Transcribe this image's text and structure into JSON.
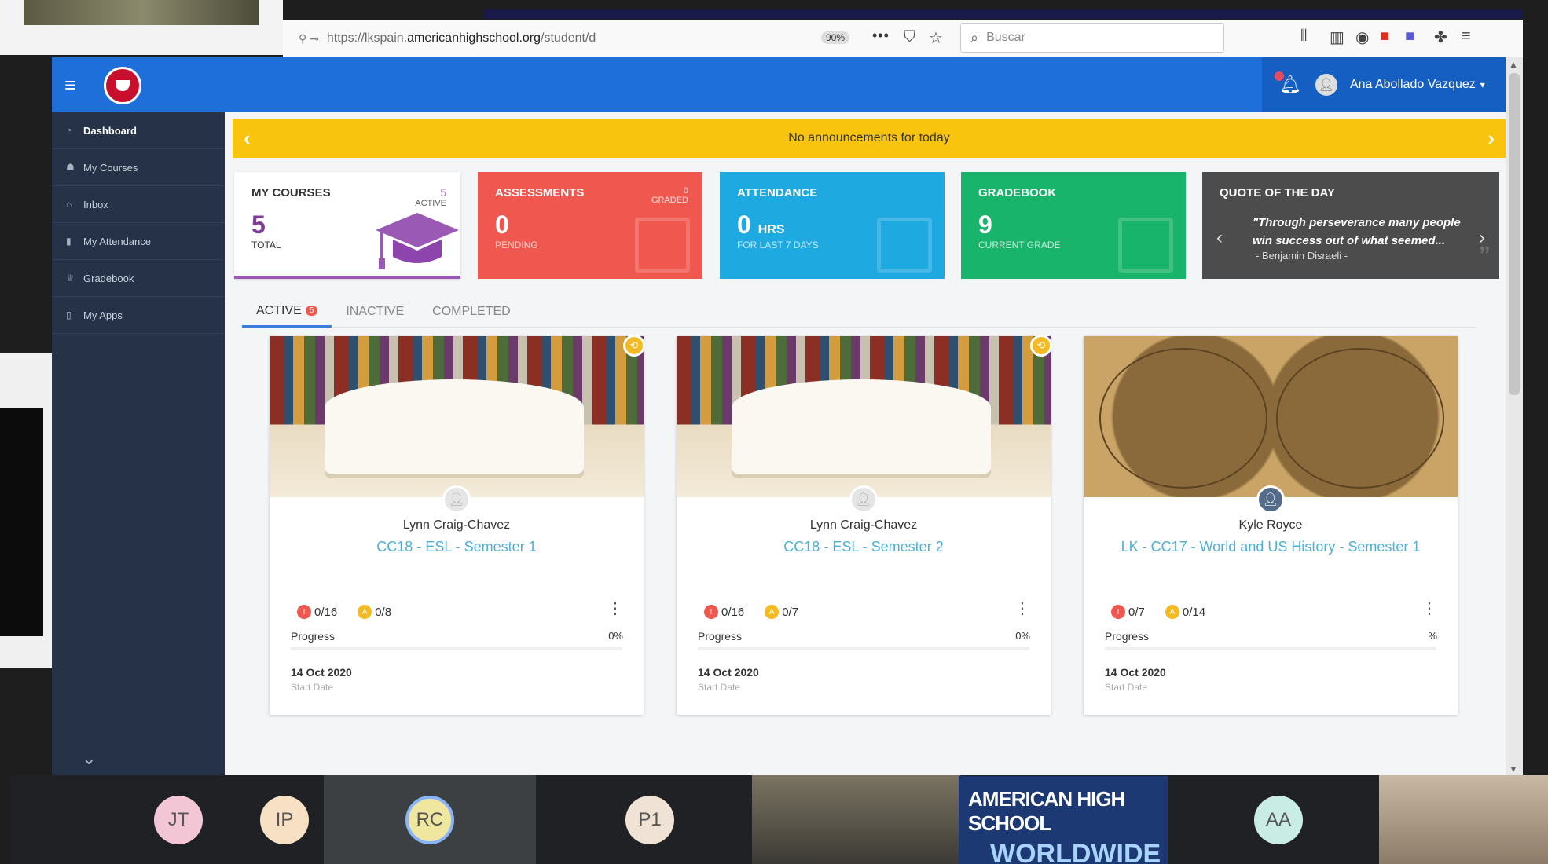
{
  "browser": {
    "url_prefix": "https://lkspain.",
    "url_domain": "americanhighschool.org",
    "url_path": "/student/d",
    "zoom": "90%",
    "search_placeholder": "Buscar"
  },
  "header": {
    "user_name": "Ana Abollado Vazquez"
  },
  "sidebar": {
    "items": [
      {
        "label": "Dashboard"
      },
      {
        "label": "My Courses"
      },
      {
        "label": "Inbox"
      },
      {
        "label": "My Attendance"
      },
      {
        "label": "Gradebook"
      },
      {
        "label": "My Apps"
      }
    ]
  },
  "announcement": {
    "text": "No announcements for today"
  },
  "stats": {
    "courses": {
      "title": "MY COURSES",
      "value": "5",
      "sub": "TOTAL",
      "corner_num": "5",
      "corner_label": "ACTIVE"
    },
    "assessments": {
      "title": "ASSESSMENTS",
      "value": "0",
      "sub": "PENDING",
      "corner_num": "0",
      "corner_label": "GRADED"
    },
    "attendance": {
      "title": "ATTENDANCE",
      "value": "0",
      "unit": "HRS",
      "sub": "FOR LAST 7 DAYS"
    },
    "gradebook": {
      "title": "GRADEBOOK",
      "value": "9",
      "sub": "CURRENT GRADE"
    },
    "quote": {
      "title": "QUOTE OF THE DAY",
      "text": "\"Through perseverance many people win success out of what seemed...",
      "author": "- Benjamin Disraeli -"
    }
  },
  "tabs": {
    "active": "ACTIVE",
    "active_count": "5",
    "inactive": "INACTIVE",
    "completed": "COMPLETED"
  },
  "courses": [
    {
      "teacher": "Lynn Craig-Chavez",
      "name": "CC18 - ESL - Semester 1",
      "red": "0/16",
      "yellow": "0/8",
      "progress_label": "Progress",
      "progress_value": "0%",
      "progress_fraction": 0,
      "start_date": "14 Oct 2020",
      "start_label": "Start Date"
    },
    {
      "teacher": "Lynn Craig-Chavez",
      "name": "CC18 - ESL - Semester 2",
      "red": "0/16",
      "yellow": "0/7",
      "progress_label": "Progress",
      "progress_value": "0%",
      "progress_fraction": 0,
      "start_date": "14 Oct 2020",
      "start_label": "Start Date"
    },
    {
      "teacher": "Kyle Royce",
      "name": "LK - CC17 - World and US History - Semester 1",
      "red": "0/7",
      "yellow": "0/14",
      "progress_label": "Progress",
      "progress_value": "%",
      "progress_fraction": 0,
      "start_date": "14 Oct 2020",
      "start_label": "Start Date"
    }
  ],
  "meet": {
    "participants": [
      {
        "initials": "JT",
        "color": "#f3c6d6"
      },
      {
        "initials": "IP",
        "color": "#f7e0c4"
      },
      {
        "initials": "RC",
        "color": "#efe6a0"
      },
      {
        "initials": "P1",
        "color": "#f1e2d6"
      },
      {
        "initials": "AA",
        "color": "#c9ece5"
      }
    ],
    "banner_line1": "AMERICAN HIGH SCHOOL",
    "banner_line2": "WORLDWIDE"
  },
  "colors": {
    "topbar": "#1e6fd9",
    "sidebar": "#253247",
    "announcement": "#f9c40d",
    "assessments": "#f0584f",
    "attendance": "#1ea9e1",
    "gradebook": "#19b46b",
    "quote": "#4c4c4c",
    "courses_accent": "#9b59b6"
  }
}
